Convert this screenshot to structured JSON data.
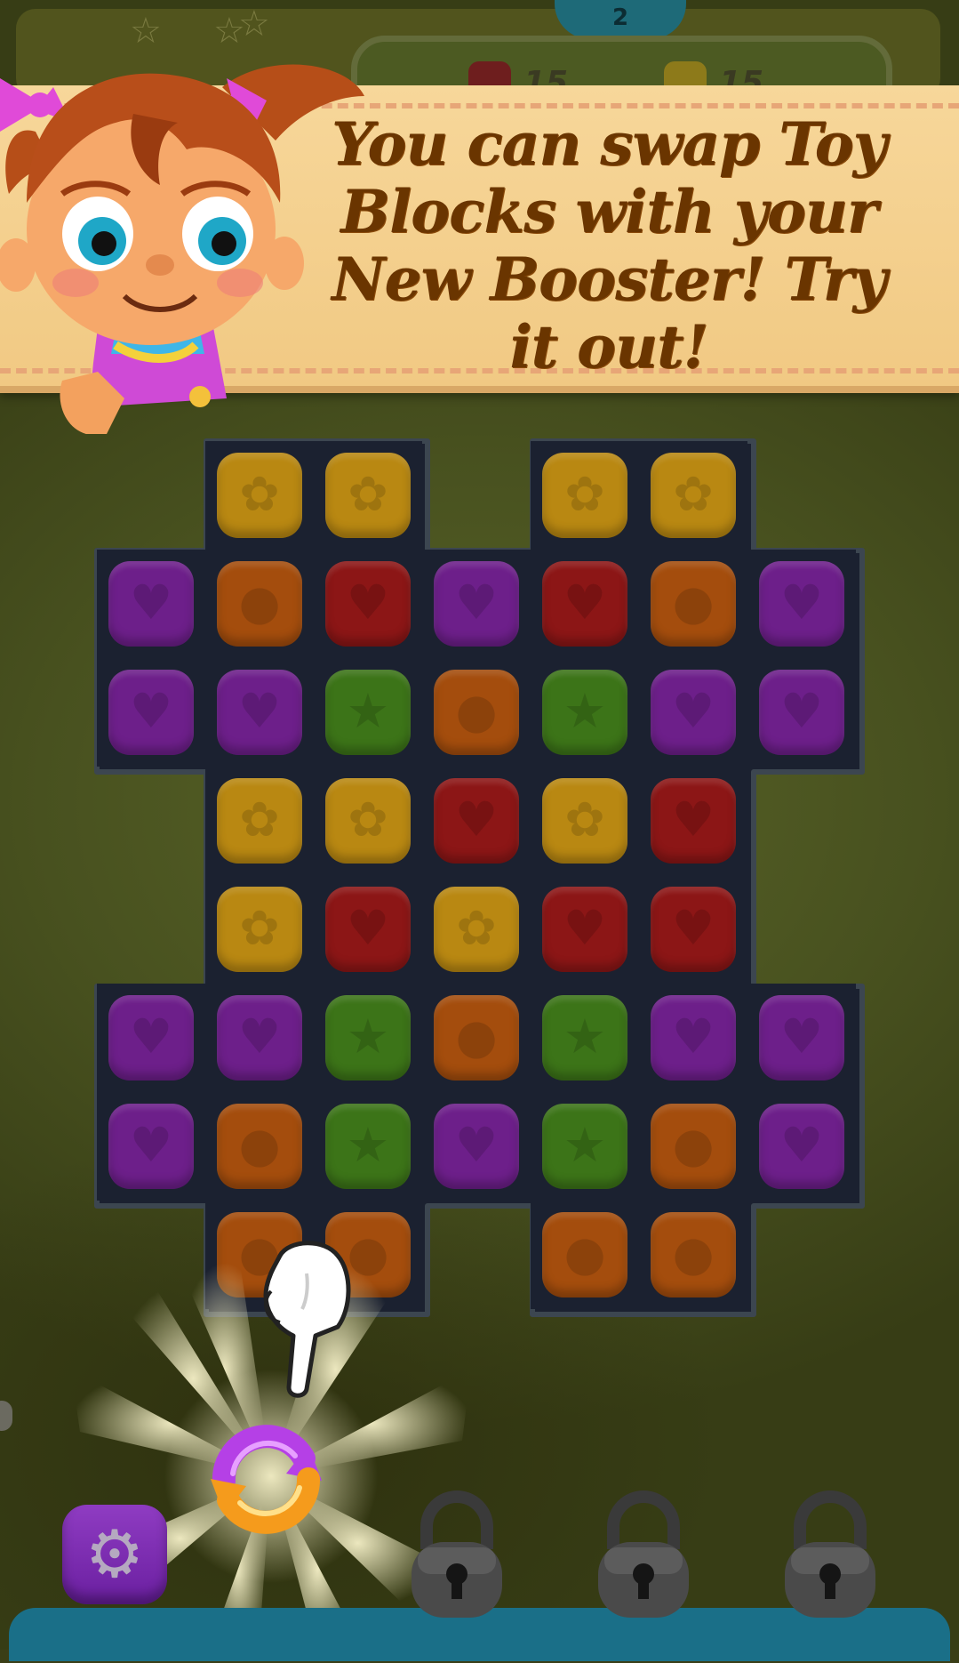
{
  "hud": {
    "moves": "2",
    "goals": [
      {
        "color": "#6e1e1e",
        "count": "15"
      },
      {
        "color": "#8d7a1a",
        "count": "15"
      }
    ],
    "stars": [
      "☆",
      "☆",
      "☆"
    ]
  },
  "tutorial": {
    "message": "You can swap Toy Blocks with your New Booster! Try it out!"
  },
  "board": {
    "colors": {
      "yellow": "#b98812",
      "orange": "#a44d0d",
      "red": "#8c1616",
      "purple": "#6d1f8a",
      "green": "#3c7418"
    },
    "shapes": {
      "yellow": "✿",
      "orange": "●",
      "red": "♥",
      "purple": "♥",
      "green": "★"
    },
    "rows": [
      [
        null,
        "yellow",
        "yellow",
        null,
        "yellow",
        "yellow",
        null
      ],
      [
        "purple",
        "orange",
        "red",
        "purple",
        "red",
        "orange",
        "purple"
      ],
      [
        "purple",
        "purple",
        "green",
        "orange",
        "green",
        "purple",
        "purple"
      ],
      [
        null,
        "yellow",
        "yellow",
        "red",
        "yellow",
        "red",
        null
      ],
      [
        null,
        "yellow",
        "red",
        "yellow",
        "red",
        "red",
        null
      ],
      [
        "purple",
        "purple",
        "green",
        "orange",
        "green",
        "purple",
        "purple"
      ],
      [
        "purple",
        "orange",
        "green",
        "purple",
        "green",
        "orange",
        "purple"
      ],
      [
        null,
        "orange",
        "orange",
        null,
        "orange",
        "orange",
        null
      ]
    ]
  },
  "boosters": {
    "settings_icon": "gear-icon",
    "active_booster": "swap-booster-icon",
    "locked_slots": 3
  }
}
